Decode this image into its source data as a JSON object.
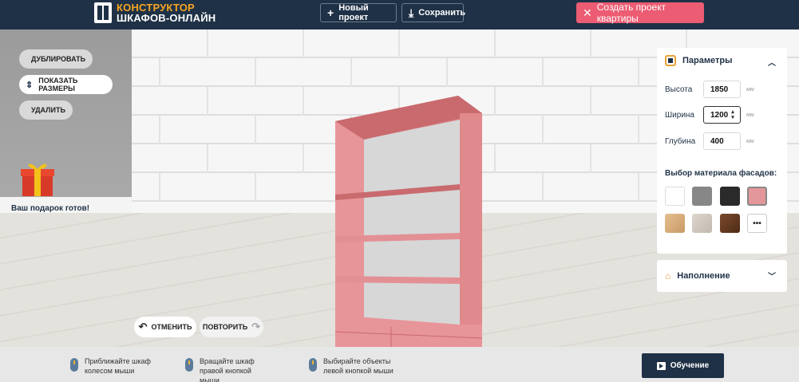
{
  "header": {
    "logo_line1": "КОНСТРУКТОР",
    "logo_line2": "ШКАФОВ-ОНЛАЙН",
    "new_project": "Новый проект",
    "save": "Сохранить",
    "create_apartment": "Создать проект квартиры"
  },
  "tools": {
    "duplicate": "ДУБЛИРОВАТЬ",
    "show_dims": "ПОКАЗАТЬ РАЗМЕРЫ",
    "delete": "УДАЛИТЬ",
    "gift": "Ваш подарок готов!",
    "undo": "ОТМЕНИТЬ",
    "redo": "ПОВТОРИТЬ"
  },
  "params": {
    "title": "Параметры",
    "height_label": "Высота",
    "height": "1850",
    "width_label": "Ширина",
    "width": "1200",
    "depth_label": "Глубина",
    "depth": "400",
    "unit": "мм",
    "material_title": "Выбор материала фасадов:",
    "more": "•••",
    "swatches": [
      "#ffffff",
      "#878787",
      "#2a2a2a",
      "#e3979a",
      "#d6ad7c",
      "#cfc8c0",
      "#6b3e25"
    ],
    "selected_color": "#e3979a"
  },
  "filling": {
    "title": "Наполнение"
  },
  "footer": {
    "hint1": "Приближайте шкаф колесом мыши",
    "hint2": "Вращайте шкаф правой кнопкой мыши",
    "hint3": "Выбирайте объекты левой кнопкой мыши",
    "tutorial": "Обучение"
  },
  "colors": {
    "header_bg": "#1f3146",
    "accent": "#ec5c72",
    "logo_orange": "#f5a623",
    "shelf": "#e08a8e"
  }
}
